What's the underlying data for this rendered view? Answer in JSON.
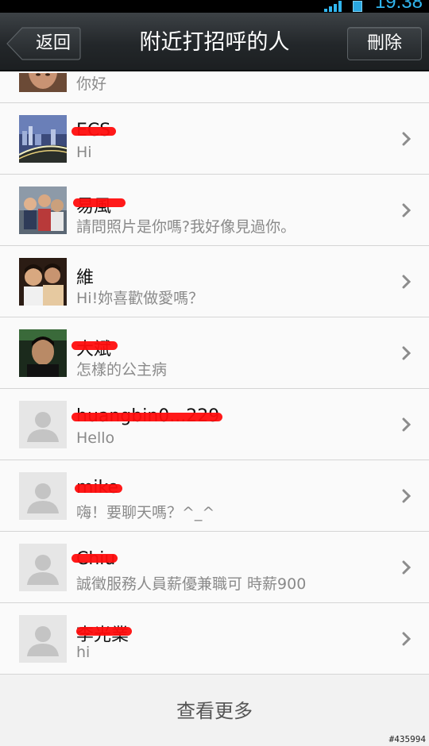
{
  "status_bar": {
    "time": "19:38"
  },
  "header": {
    "back_label": "返回",
    "title": "附近打招呼的人",
    "delete_label": "刪除"
  },
  "top_partial": {
    "message": "你好"
  },
  "rows": [
    {
      "name": "ECS",
      "message": "Hi",
      "avatar": "night-city-photo",
      "name_redacted": true
    },
    {
      "name": "易風",
      "message": "請問照片是你嗎?我好像見過你。",
      "avatar": "group-photo",
      "name_redacted": true
    },
    {
      "name": "維",
      "message": "Hi!妳喜歡做愛嗎？",
      "avatar": "two-people-photo",
      "name_redacted": false
    },
    {
      "name": "大斌",
      "message": "怎樣的公主病",
      "avatar": "man-portrait-photo",
      "name_redacted": true
    },
    {
      "name": "huangbin0...229",
      "message": "Hello",
      "avatar": "default-person-icon",
      "name_redacted": true
    },
    {
      "name": "mike",
      "message": "嗨！要聊天嗎？^_^",
      "avatar": "default-person-icon",
      "name_redacted": true
    },
    {
      "name": "Chiu",
      "message": "誠徵服務人員薪優兼職可 時薪900",
      "avatar": "default-person-icon",
      "name_redacted": true
    },
    {
      "name": "李光業",
      "message": "hi",
      "avatar": "default-person-icon",
      "name_redacted": true
    }
  ],
  "footer": {
    "more_label": "查看更多"
  },
  "watermark": "#435994",
  "colors": {
    "redaction": "#ff0d0d",
    "status_accent": "#31b6ef",
    "header_bg": "#23272a"
  }
}
